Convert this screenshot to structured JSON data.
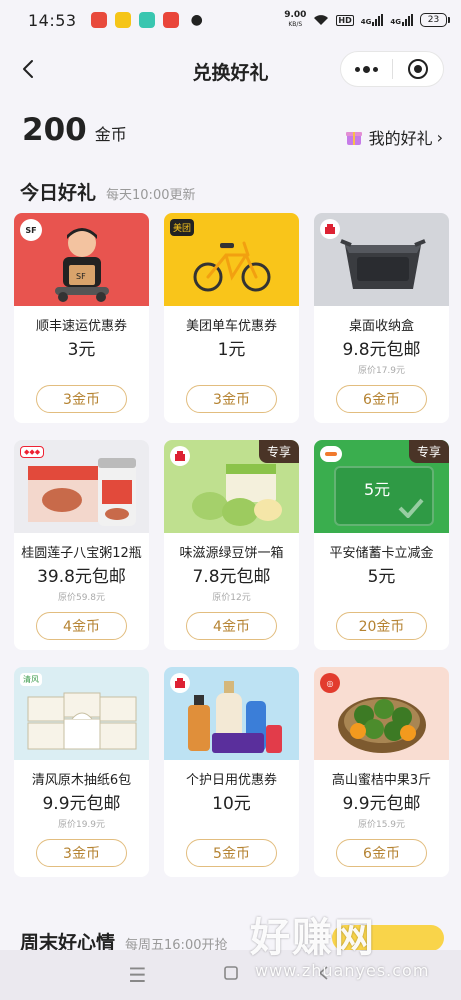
{
  "status": {
    "time": "14:53",
    "speed_value": "9.00",
    "speed_unit": "KB/S",
    "hd": "HD",
    "network1": "4G",
    "network2": "4G",
    "battery": "23"
  },
  "header": {
    "title": "兑换好礼"
  },
  "balance": {
    "amount": "200",
    "unit": "金币",
    "my_gifts": "我的好礼"
  },
  "section_today": {
    "title": "今日好礼",
    "subtitle": "每天10:00更新"
  },
  "section_weekend": {
    "title": "周末好心情",
    "subtitle": "每周五16:00开抢"
  },
  "colors": {
    "accent": "#b58332",
    "button_border": "#e2bd7f",
    "tag_orange": "#f07a2e",
    "tag_dark": "#4a3427",
    "sf_red": "#e8544f",
    "meituan_yellow": "#f9c51a"
  },
  "products": [
    {
      "name": "顺丰速运优惠券",
      "price": "3元",
      "original": "",
      "button": "3金币",
      "tag": "",
      "logo": "SF",
      "icon": "courier-icon"
    },
    {
      "name": "美团单车优惠券",
      "price": "1元",
      "original": "",
      "button": "3金币",
      "tag": "",
      "logo": "美团",
      "icon": "bicycle-icon"
    },
    {
      "name": "桌面收纳盒",
      "price": "9.8元包邮",
      "original": "原价17.9元",
      "button": "6金币",
      "tag": "",
      "logo": "",
      "icon": "storage-box-icon"
    },
    {
      "name": "桂圆莲子八宝粥12瓶",
      "price": "39.8元包邮",
      "original": "原价59.8元",
      "button": "4金币",
      "tag": "",
      "logo": "",
      "icon": "porridge-icon"
    },
    {
      "name": "味滋源绿豆饼一箱",
      "price": "7.8元包邮",
      "original": "原价12元",
      "button": "4金币",
      "tag": "专享",
      "logo": "",
      "icon": "mung-bean-cake-icon"
    },
    {
      "name": "平安储蓄卡立减金",
      "price": "5元",
      "original": "",
      "button": "20金币",
      "tag": "专享",
      "logo": "",
      "icon": "cash-card-icon"
    },
    {
      "name": "清风原木抽纸6包",
      "price": "9.9元包邮",
      "original": "原价19.9元",
      "button": "3金币",
      "tag": "",
      "logo": "",
      "icon": "tissue-icon"
    },
    {
      "name": "个护日用优惠券",
      "price": "10元",
      "original": "",
      "button": "5金币",
      "tag": "",
      "logo": "",
      "icon": "personal-care-icon"
    },
    {
      "name": "高山蜜桔中果3斤",
      "price": "9.9元包邮",
      "original": "原价15.9元",
      "button": "6金币",
      "tag": "",
      "logo": "",
      "icon": "tangerine-icon"
    }
  ],
  "card5_text": "5元",
  "watermark": {
    "big": "好赚网",
    "small": "www.zhuanyes.com"
  }
}
